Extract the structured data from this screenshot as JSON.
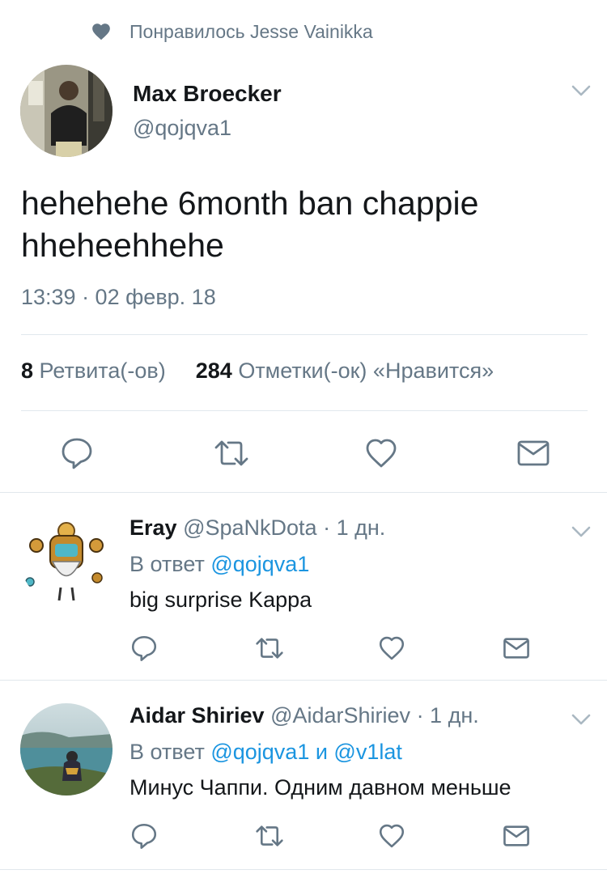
{
  "liked_by": {
    "text": "Понравилось Jesse Vainikka"
  },
  "tweet": {
    "name": "Max Broecker",
    "handle": "@qojqva1",
    "text": "hehehehe 6month ban chappie hheheehhehe",
    "time": "13:39 · 02 февр. 18",
    "retweets_count": "8",
    "retweets_label": "Ретвита(-ов)",
    "likes_count": "284",
    "likes_label": "Отметки(-ок) «Нравится»"
  },
  "replies": [
    {
      "name": "Eray",
      "handle": "@SpaNkDota",
      "age": "· 1 дн.",
      "reply_prefix": "В ответ",
      "reply_mentions": "@qojqva1",
      "text": "big surprise Kappa"
    },
    {
      "name": "Aidar Shiriev",
      "handle": "@AidarShiriev",
      "age": "· 1 дн.",
      "reply_prefix": "В ответ",
      "reply_mentions": "@qojqva1 и @v1lat",
      "text": "Минус Чаппи. Одним давном меньше"
    }
  ],
  "icons": [
    "heart-icon",
    "chevron-down-icon",
    "reply-icon",
    "retweet-icon",
    "like-icon",
    "direct-message-icon"
  ],
  "colors": {
    "text": "#14171a",
    "secondary": "#657786",
    "link": "#1b95e0",
    "divider": "#e1e8ed"
  }
}
